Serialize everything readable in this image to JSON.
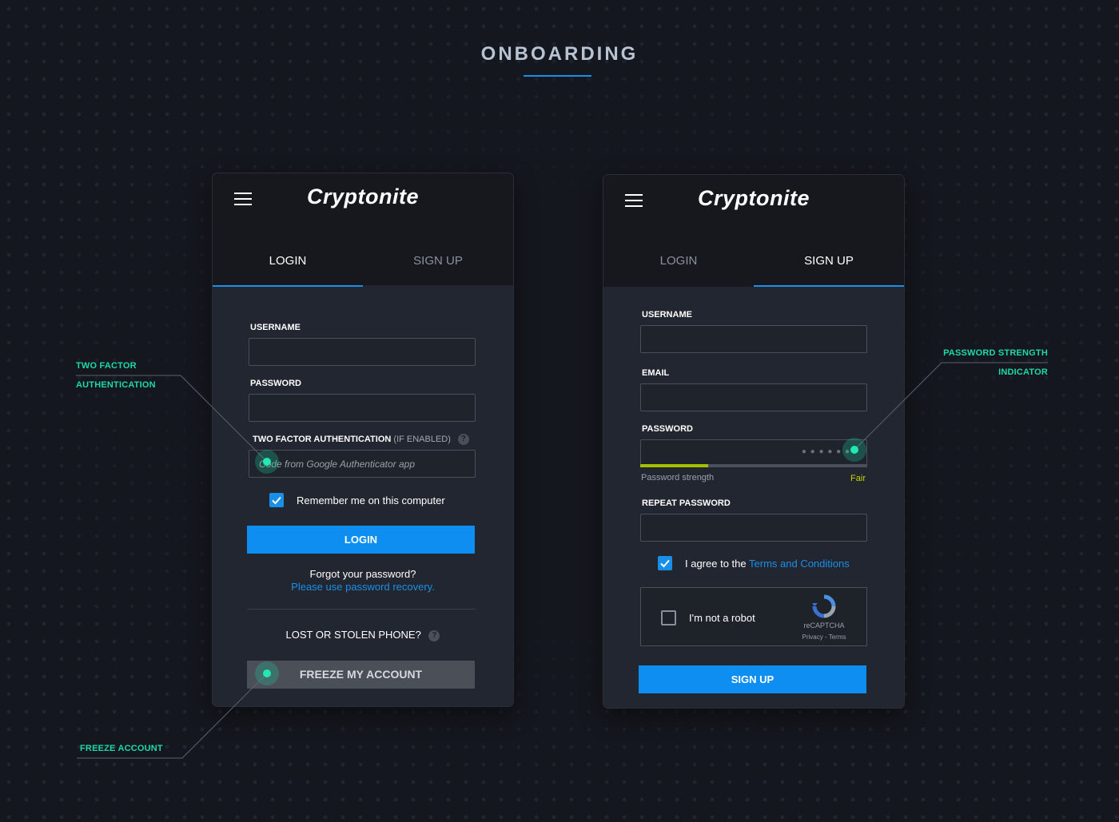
{
  "page": {
    "title": "ONBOARDING"
  },
  "login_card": {
    "brand": "Cryptonite",
    "tabs": [
      {
        "label": "LOGIN",
        "active": true
      },
      {
        "label": "SIGN UP",
        "active": false
      }
    ],
    "username_label": "USERNAME",
    "password_label": "PASSWORD",
    "twofa_label": "TWO FACTOR AUTHENTICATION",
    "twofa_note": "(IF ENABLED)",
    "twofa_placeholder": "Code from Google Authenticator app",
    "remember_label": "Remember me on this computer",
    "remember_checked": true,
    "login_button": "LOGIN",
    "forgot_text": "Forgot your password?",
    "recovery_link": "Please use password recovery.",
    "lost_phone_text": "LOST OR STOLEN PHONE?",
    "freeze_button": "FREEZE MY ACCOUNT",
    "help_glyph": "?"
  },
  "signup_card": {
    "brand": "Cryptonite",
    "tabs": [
      {
        "label": "LOGIN",
        "active": false
      },
      {
        "label": "SIGN UP",
        "active": true
      }
    ],
    "username_label": "USERNAME",
    "email_label": "EMAIL",
    "password_label": "PASSWORD",
    "password_mask": "● ● ● ● ● ●",
    "strength_label": "Password strength",
    "strength_value": "Fair",
    "strength_level": 0.3,
    "repeat_label": "REPEAT PASSWORD",
    "agree_text": "I agree to the",
    "terms_link": "Terms and Conditions",
    "agree_checked": true,
    "captcha_label": "I'm not a robot",
    "captcha_brand": "reCAPTCHA",
    "captcha_links": "Privacy - Terms",
    "signup_button": "SIGN UP"
  },
  "annotations": {
    "two_factor_line1": "TWO FACTOR",
    "two_factor_line2": "AUTHENTICATION",
    "freeze": "FREEZE ACCOUNT",
    "strength_line1": "PASSWORD STRENGTH",
    "strength_line2": "INDICATOR"
  },
  "colors": {
    "background": "#14171d",
    "accent": "#0d8ef0",
    "annotation": "#1fd9a8",
    "strength_bar": "#a4c000",
    "strength_text": "#c9d400"
  }
}
